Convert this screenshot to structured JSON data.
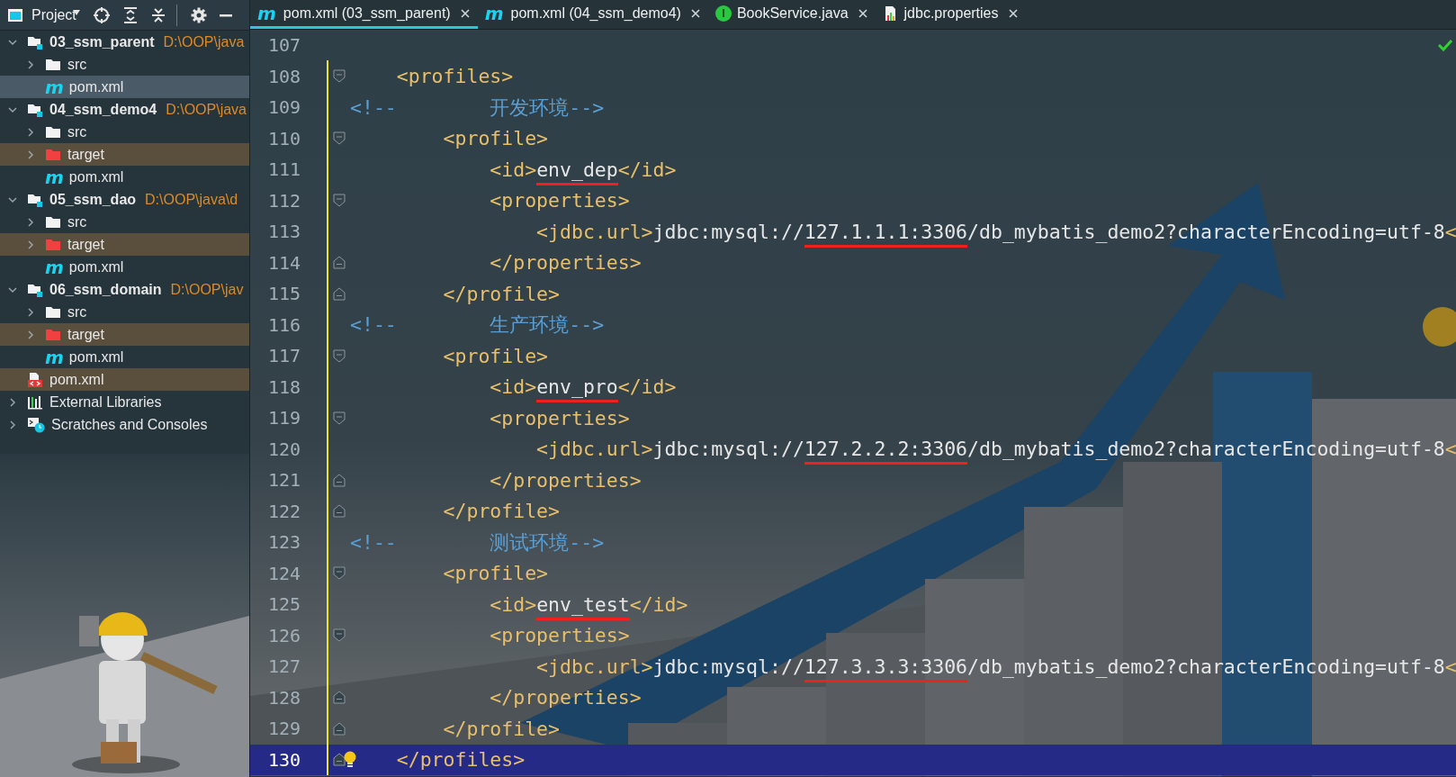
{
  "sidebar": {
    "title": "Project",
    "items": [
      {
        "label": "03_ssm_parent",
        "path": "D:\\OOP\\java",
        "kind": "module",
        "expanded": true,
        "selected": false,
        "ignored": false,
        "children": [
          {
            "label": "src",
            "kind": "folder",
            "expanded": false,
            "selected": false,
            "ignored": false
          },
          {
            "label": "pom.xml",
            "kind": "maven",
            "badge": "m",
            "selected": true,
            "ignored": false
          }
        ]
      },
      {
        "label": "04_ssm_demo4",
        "path": "D:\\OOP\\java",
        "kind": "module",
        "expanded": true,
        "selected": false,
        "ignored": false,
        "children": [
          {
            "label": "src",
            "kind": "folder",
            "expanded": false,
            "selected": false,
            "ignored": false
          },
          {
            "label": "target",
            "kind": "excluded-folder",
            "expanded": false,
            "selected": false,
            "ignored": true
          },
          {
            "label": "pom.xml",
            "kind": "maven",
            "badge": "m",
            "selected": false,
            "ignored": false
          }
        ]
      },
      {
        "label": "05_ssm_dao",
        "path": "D:\\OOP\\java\\d",
        "kind": "module",
        "expanded": true,
        "selected": false,
        "ignored": false,
        "children": [
          {
            "label": "src",
            "kind": "folder",
            "expanded": false,
            "selected": false,
            "ignored": false
          },
          {
            "label": "target",
            "kind": "excluded-folder",
            "expanded": false,
            "selected": false,
            "ignored": true
          },
          {
            "label": "pom.xml",
            "kind": "maven",
            "badge": "m",
            "selected": false,
            "ignored": false
          }
        ]
      },
      {
        "label": "06_ssm_domain",
        "path": "D:\\OOP\\jav",
        "kind": "module",
        "expanded": true,
        "selected": false,
        "ignored": false,
        "children": [
          {
            "label": "src",
            "kind": "folder",
            "expanded": false,
            "selected": false,
            "ignored": false
          },
          {
            "label": "target",
            "kind": "excluded-folder",
            "expanded": false,
            "selected": false,
            "ignored": true
          },
          {
            "label": "pom.xml",
            "kind": "maven",
            "badge": "m",
            "selected": false,
            "ignored": false
          }
        ]
      },
      {
        "label": "pom.xml",
        "kind": "xml",
        "selected": false,
        "ignored": true
      },
      {
        "label": "External Libraries",
        "kind": "libraries",
        "expanded": false,
        "selected": false,
        "ignored": false
      },
      {
        "label": "Scratches and Consoles",
        "kind": "scratches",
        "expanded": false,
        "selected": false,
        "ignored": false
      }
    ]
  },
  "tabs": [
    {
      "label": "pom.xml (03_ssm_parent)",
      "kind": "maven",
      "badge": "m",
      "selected": true
    },
    {
      "label": "pom.xml (04_ssm_demo4)",
      "kind": "maven",
      "badge": "m",
      "selected": false
    },
    {
      "label": "BookService.java",
      "kind": "interface",
      "badge": "I",
      "selected": false
    },
    {
      "label": "jdbc.properties",
      "kind": "properties",
      "selected": false
    }
  ],
  "editor": {
    "inspection_ok": true,
    "lines": [
      {
        "number": "107",
        "modified": false,
        "current": false
      },
      {
        "number": "108",
        "modified": true,
        "current": false,
        "fold_open": true,
        "tokens": [
          {
            "kind": "tag",
            "text": "    <profiles>"
          }
        ]
      },
      {
        "number": "109",
        "modified": true,
        "current": false,
        "tokens": [
          {
            "kind": "comment",
            "text": "<!--        开发环境-->"
          }
        ]
      },
      {
        "number": "110",
        "modified": true,
        "current": false,
        "fold_open": true,
        "tokens": [
          {
            "kind": "tag",
            "text": "        <profile>"
          }
        ]
      },
      {
        "number": "111",
        "modified": true,
        "current": false,
        "tokens": [
          {
            "kind": "tag",
            "text": "            <id>"
          },
          {
            "kind": "text",
            "text": "env_dep",
            "underlined": true
          },
          {
            "kind": "tag",
            "text": "</id>"
          }
        ]
      },
      {
        "number": "112",
        "modified": true,
        "current": false,
        "fold_open": true,
        "tokens": [
          {
            "kind": "tag",
            "text": "            <properties>"
          }
        ]
      },
      {
        "number": "113",
        "modified": true,
        "current": false,
        "tokens": [
          {
            "kind": "tag",
            "text": "                <jdbc.url>"
          },
          {
            "kind": "text",
            "text": "jdbc:mysql://"
          },
          {
            "kind": "text",
            "text": "127.1.1.1:3306",
            "underlined": true
          },
          {
            "kind": "text",
            "text": "/db_mybatis_demo2?characterEncoding=utf-8"
          },
          {
            "kind": "tag",
            "text": "<"
          }
        ]
      },
      {
        "number": "114",
        "modified": true,
        "current": false,
        "fold_close": true,
        "tokens": [
          {
            "kind": "tag",
            "text": "            </properties>"
          }
        ]
      },
      {
        "number": "115",
        "modified": true,
        "current": false,
        "fold_close": true,
        "tokens": [
          {
            "kind": "tag",
            "text": "        </profile>"
          }
        ]
      },
      {
        "number": "116",
        "modified": true,
        "current": false,
        "tokens": [
          {
            "kind": "comment",
            "text": "<!--        生产环境-->"
          }
        ]
      },
      {
        "number": "117",
        "modified": true,
        "current": false,
        "fold_open": true,
        "tokens": [
          {
            "kind": "tag",
            "text": "        <profile>"
          }
        ]
      },
      {
        "number": "118",
        "modified": true,
        "current": false,
        "tokens": [
          {
            "kind": "tag",
            "text": "            <id>"
          },
          {
            "kind": "text",
            "text": "env_pro",
            "underlined": true
          },
          {
            "kind": "tag",
            "text": "</id>"
          }
        ]
      },
      {
        "number": "119",
        "modified": true,
        "current": false,
        "fold_open": true,
        "tokens": [
          {
            "kind": "tag",
            "text": "            <properties>"
          }
        ]
      },
      {
        "number": "120",
        "modified": true,
        "current": false,
        "tokens": [
          {
            "kind": "tag",
            "text": "                <jdbc.url>"
          },
          {
            "kind": "text",
            "text": "jdbc:mysql://"
          },
          {
            "kind": "text",
            "text": "127.2.2.2:3306",
            "underlined": true
          },
          {
            "kind": "text",
            "text": "/db_mybatis_demo2?characterEncoding=utf-8"
          },
          {
            "kind": "tag",
            "text": "<"
          }
        ]
      },
      {
        "number": "121",
        "modified": true,
        "current": false,
        "fold_close": true,
        "tokens": [
          {
            "kind": "tag",
            "text": "            </properties>"
          }
        ]
      },
      {
        "number": "122",
        "modified": true,
        "current": false,
        "fold_close": true,
        "tokens": [
          {
            "kind": "tag",
            "text": "        </profile>"
          }
        ]
      },
      {
        "number": "123",
        "modified": true,
        "current": false,
        "tokens": [
          {
            "kind": "comment",
            "text": "<!--        测试环境-->"
          }
        ]
      },
      {
        "number": "124",
        "modified": true,
        "current": false,
        "fold_open": true,
        "tokens": [
          {
            "kind": "tag",
            "text": "        <profile>"
          }
        ]
      },
      {
        "number": "125",
        "modified": true,
        "current": false,
        "tokens": [
          {
            "kind": "tag",
            "text": "            <id>"
          },
          {
            "kind": "text",
            "text": "env_test",
            "underlined": true
          },
          {
            "kind": "tag",
            "text": "</id>"
          }
        ]
      },
      {
        "number": "126",
        "modified": true,
        "current": false,
        "fold_open": true,
        "tokens": [
          {
            "kind": "tag",
            "text": "            <properties>"
          }
        ]
      },
      {
        "number": "127",
        "modified": true,
        "current": false,
        "tokens": [
          {
            "kind": "tag",
            "text": "                <jdbc.url>"
          },
          {
            "kind": "text",
            "text": "jdbc:mysql://"
          },
          {
            "kind": "text",
            "text": "127.3.3.3:3306",
            "underlined": true
          },
          {
            "kind": "text",
            "text": "/db_mybatis_demo2?characterEncoding=utf-8"
          },
          {
            "kind": "tag",
            "text": "<"
          }
        ]
      },
      {
        "number": "128",
        "modified": true,
        "current": false,
        "fold_close": true,
        "tokens": [
          {
            "kind": "tag",
            "text": "            </properties>"
          }
        ]
      },
      {
        "number": "129",
        "modified": true,
        "current": false,
        "fold_close": true,
        "tokens": [
          {
            "kind": "tag",
            "text": "        </profile>"
          }
        ]
      },
      {
        "number": "130",
        "modified": true,
        "current": true,
        "fold_close": true,
        "bulb": true,
        "tokens": [
          {
            "kind": "tag",
            "text": "    </profiles>"
          }
        ]
      }
    ]
  }
}
